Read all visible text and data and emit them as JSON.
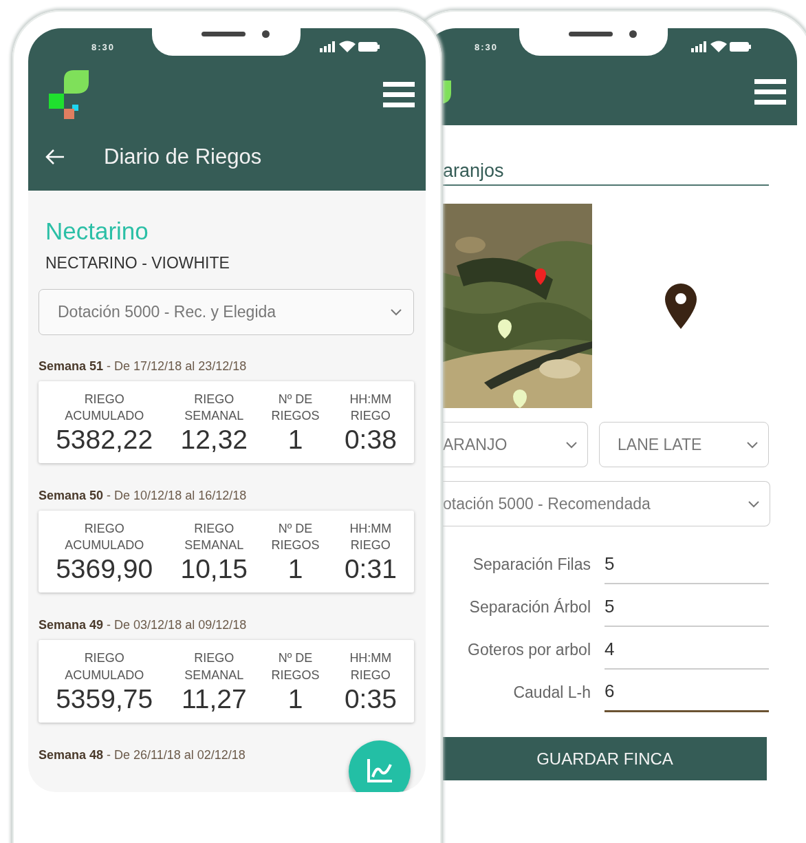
{
  "left_screen": {
    "status_time": "8:30",
    "title": "Diario de Riegos",
    "crop": "Nectarino",
    "variety": "NECTARINO - VIOWHITE",
    "plan_select": "Dotación 5000 - Rec. y Elegida",
    "weeks": [
      {
        "label": "**Semana 51** - De 17/12/18 al 23/12/18",
        "stats": [
          {
            "label": "RIEGO\nACUMULADO",
            "value": "5382,22"
          },
          {
            "label": "RIEGO\nSEMANAL",
            "value": "12,32"
          },
          {
            "label": "Nº DE\nRIEGOS",
            "value": "1"
          },
          {
            "label": "HH:MM\nRIEGO",
            "value": "0:38"
          }
        ]
      },
      {
        "label": "**Semana 50** - De 10/12/18 al 16/12/18",
        "stats": [
          {
            "label": "RIEGO\nACUMULADO",
            "value": "5369,90"
          },
          {
            "label": "RIEGO\nSEMANAL",
            "value": "10,15"
          },
          {
            "label": "Nº DE\nRIEGOS",
            "value": "1"
          },
          {
            "label": "HH:MM\nRIEGO",
            "value": "0:31"
          }
        ]
      },
      {
        "label": "**Semana 49** - De 03/12/18 al 09/12/18",
        "stats": [
          {
            "label": "RIEGO\nACUMULADO",
            "value": "5359,75"
          },
          {
            "label": "RIEGO\nSEMANAL",
            "value": "11,27"
          },
          {
            "label": "Nº DE\nRIEGOS",
            "value": "1"
          },
          {
            "label": "HH:MM\nRIEGO",
            "value": "0:35"
          }
        ]
      },
      {
        "label": "**Semana 48** - De 26/11/18 al 02/12/18"
      }
    ]
  },
  "right_screen": {
    "status_time": "8:30",
    "name_field": "aranjos",
    "selects": [
      "ARANJO",
      "LANE LATE"
    ],
    "plan_select": "otación 5000 - Recomendada",
    "fields": [
      {
        "label": "Separación Filas",
        "value": "5",
        "focused": false
      },
      {
        "label": "Separación Árbol",
        "value": "5",
        "focused": false
      },
      {
        "label": "Goteros por arbol",
        "value": "4",
        "focused": false
      },
      {
        "label": "Caudal L-h",
        "value": "6",
        "focused": true
      }
    ],
    "save_button": "GUARDAR FINCA"
  }
}
